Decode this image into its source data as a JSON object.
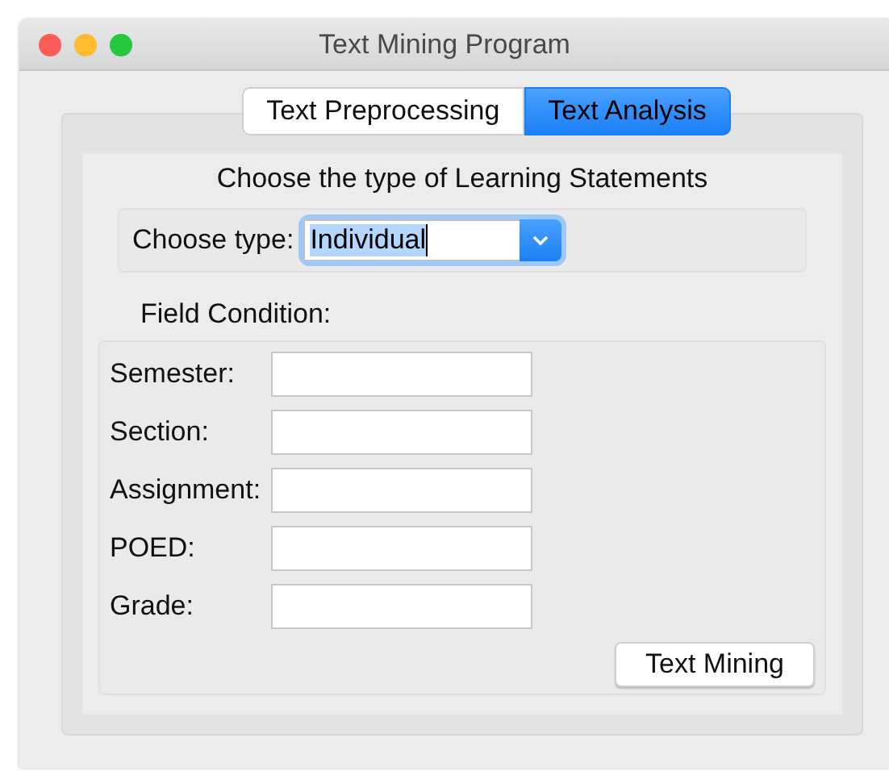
{
  "window": {
    "title": "Text Mining Program"
  },
  "tabs": [
    {
      "label": "Text Preprocessing",
      "selected": false
    },
    {
      "label": "Text Analysis",
      "selected": true
    }
  ],
  "heading": "Choose the type of Learning Statements",
  "choose_type": {
    "label": "Choose type:",
    "value": "Individual",
    "focused": true
  },
  "field_condition": {
    "title": "Field Condition:",
    "fields": [
      {
        "label": "Semester:"
      },
      {
        "label": "Section:"
      },
      {
        "label": "Assignment:"
      },
      {
        "label": "POED:"
      },
      {
        "label": "Grade:"
      }
    ]
  },
  "button": "Text Mining"
}
